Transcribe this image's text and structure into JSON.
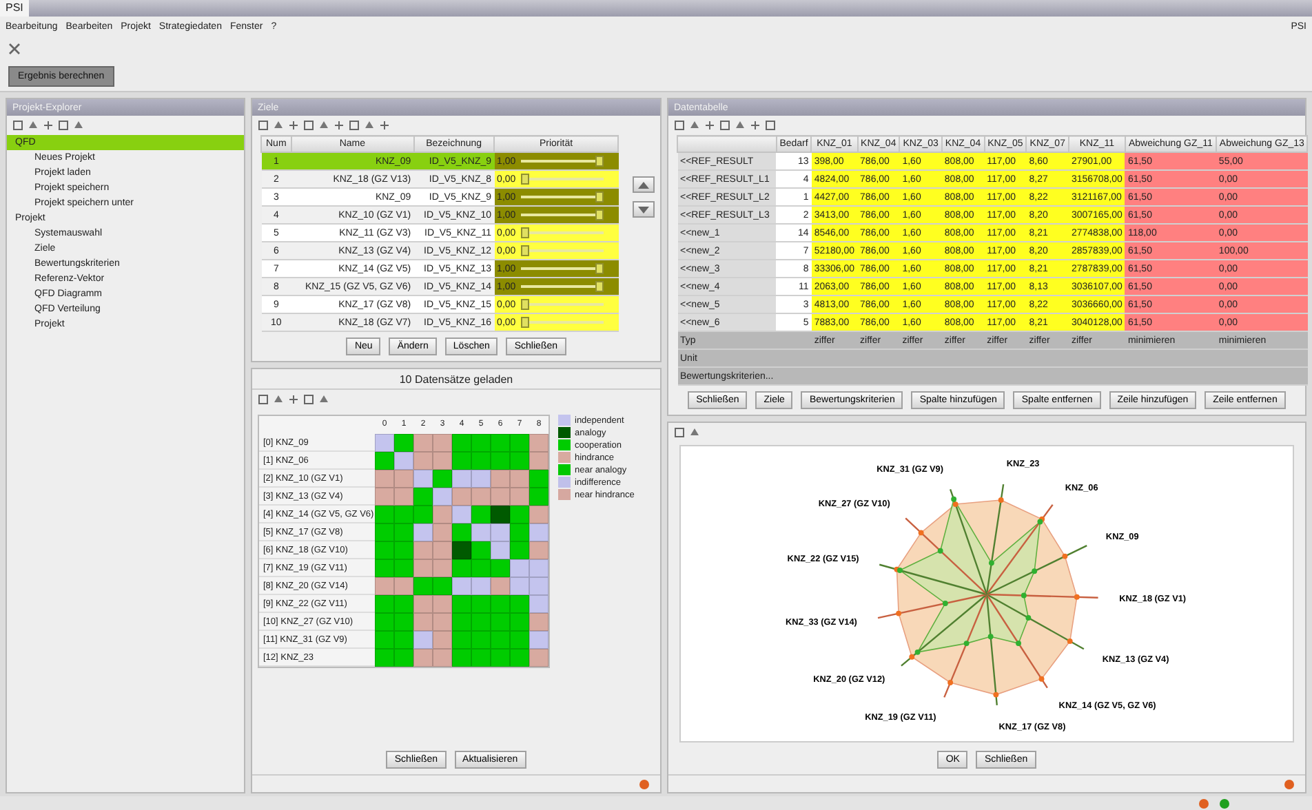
{
  "window": {
    "logo": "PSI",
    "brand": "PSI"
  },
  "menu": [
    "Bearbeitung",
    "Bearbeiten",
    "Projekt",
    "Strategiedaten",
    "Fenster",
    "?"
  ],
  "action_button": "Ergebnis berechnen",
  "sidebar": {
    "title": "Projekt-Explorer",
    "items": [
      {
        "label": "QFD",
        "selected": true,
        "children": [
          {
            "label": "Neues Projekt",
            "selected": false
          },
          {
            "label": "Projekt laden",
            "selected": false
          },
          {
            "label": "Projekt speichern",
            "selected": false
          },
          {
            "label": "Projekt speichern unter",
            "selected": false
          }
        ]
      },
      {
        "label": "Projekt",
        "selected": false,
        "children": [
          {
            "label": "Systemauswahl",
            "selected": false
          },
          {
            "label": "Ziele",
            "selected": false
          },
          {
            "label": "Bewertungskriterien",
            "selected": false
          },
          {
            "label": "Referenz-Vektor",
            "selected": false
          },
          {
            "label": "QFD Diagramm",
            "selected": false
          },
          {
            "label": "QFD Verteilung",
            "selected": false
          },
          {
            "label": "Projekt",
            "selected": false
          }
        ]
      }
    ]
  },
  "goals": {
    "title": "Ziele",
    "columns": [
      "Num",
      "Name",
      "Bezeichnung",
      "Priorität"
    ],
    "rows": [
      {
        "num": "1",
        "name": "KNZ_09",
        "code": "ID_V5_KNZ_9",
        "priority": "1,00",
        "level": 1,
        "selected": true
      },
      {
        "num": "2",
        "name": "KNZ_18 (GZ V13)",
        "code": "ID_V5_KNZ_8",
        "priority": "0,00",
        "level": 0,
        "selected": false
      },
      {
        "num": "3",
        "name": "KNZ_09",
        "code": "ID_V5_KNZ_9",
        "priority": "1,00",
        "level": 1,
        "selected": false
      },
      {
        "num": "4",
        "name": "KNZ_10 (GZ V1)",
        "code": "ID_V5_KNZ_10",
        "priority": "1,00",
        "level": 1,
        "selected": false
      },
      {
        "num": "5",
        "name": "KNZ_11 (GZ V3)",
        "code": "ID_V5_KNZ_11",
        "priority": "0,00",
        "level": 0,
        "selected": false
      },
      {
        "num": "6",
        "name": "KNZ_13 (GZ V4)",
        "code": "ID_V5_KNZ_12",
        "priority": "0,00",
        "level": 0,
        "selected": false
      },
      {
        "num": "7",
        "name": "KNZ_14 (GZ V5)",
        "code": "ID_V5_KNZ_13",
        "priority": "1,00",
        "level": 1,
        "selected": false
      },
      {
        "num": "8",
        "name": "KNZ_15 (GZ V5, GZ V6)",
        "code": "ID_V5_KNZ_14",
        "priority": "1,00",
        "level": 1,
        "selected": false
      },
      {
        "num": "9",
        "name": "KNZ_17 (GZ V8)",
        "code": "ID_V5_KNZ_15",
        "priority": "0,00",
        "level": 0,
        "selected": false
      },
      {
        "num": "10",
        "name": "KNZ_18 (GZ V7)",
        "code": "ID_V5_KNZ_16",
        "priority": "0,00",
        "level": 0,
        "selected": false
      }
    ],
    "buttons": [
      "Neu",
      "Ändern",
      "Löschen",
      "Schließen"
    ]
  },
  "matrix": {
    "status": "10 Datensätze geladen",
    "columns": [
      "0",
      "1",
      "2",
      "3",
      "4",
      "5",
      "6",
      "7",
      "8"
    ],
    "legend": [
      {
        "label": "independent",
        "color": "#c4c4ee"
      },
      {
        "label": "analogy",
        "color": "#005a00"
      },
      {
        "label": "cooperation",
        "color": "#00cc00"
      },
      {
        "label": "hindrance",
        "color": "#d8aaa0"
      },
      {
        "label": "near analogy",
        "color": "#00c800"
      },
      {
        "label": "indifference",
        "color": "#c0c0ea"
      },
      {
        "label": "near hindrance",
        "color": "#d6a8a0"
      }
    ],
    "rows": [
      {
        "label": "[0] KNZ_09",
        "cells": [
          {
            "color": "#c4c4ee"
          },
          {
            "color": "#00cc00"
          },
          {
            "color": "#d8aaa0"
          },
          {
            "color": "#d8aaa0"
          },
          {
            "color": "#00cc00"
          },
          {
            "color": "#00cc00"
          },
          {
            "color": "#00cc00"
          },
          {
            "color": "#00cc00"
          },
          {
            "color": "#d8aaa0"
          }
        ]
      },
      {
        "label": "[1] KNZ_06",
        "cells": [
          {
            "color": "#00cc00"
          },
          {
            "color": "#c4c4ee"
          },
          {
            "color": "#d8aaa0"
          },
          {
            "color": "#d8aaa0"
          },
          {
            "color": "#00cc00"
          },
          {
            "color": "#00cc00"
          },
          {
            "color": "#00cc00"
          },
          {
            "color": "#00cc00"
          },
          {
            "color": "#d8aaa0"
          }
        ]
      },
      {
        "label": "[2] KNZ_10 (GZ V1)",
        "cells": [
          {
            "color": "#d8aaa0"
          },
          {
            "color": "#d8aaa0"
          },
          {
            "color": "#c4c4ee"
          },
          {
            "color": "#00cc00"
          },
          {
            "color": "#c4c4ee"
          },
          {
            "color": "#c4c4ee"
          },
          {
            "color": "#d8aaa0"
          },
          {
            "color": "#d8aaa0"
          },
          {
            "color": "#00cc00"
          }
        ]
      },
      {
        "label": "[3] KNZ_13 (GZ V4)",
        "cells": [
          {
            "color": "#d8aaa0"
          },
          {
            "color": "#d8aaa0"
          },
          {
            "color": "#00cc00"
          },
          {
            "color": "#c4c4ee"
          },
          {
            "color": "#d8aaa0"
          },
          {
            "color": "#d8aaa0"
          },
          {
            "color": "#d8aaa0"
          },
          {
            "color": "#d8aaa0"
          },
          {
            "color": "#00cc00"
          }
        ]
      },
      {
        "label": "[4] KNZ_14 (GZ V5, GZ V6)",
        "cells": [
          {
            "color": "#00cc00"
          },
          {
            "color": "#00cc00"
          },
          {
            "color": "#00cc00"
          },
          {
            "color": "#d8aaa0"
          },
          {
            "color": "#c4c4ee"
          },
          {
            "color": "#00cc00"
          },
          {
            "color": "#005a00"
          },
          {
            "color": "#00cc00"
          },
          {
            "color": "#d8aaa0"
          }
        ]
      },
      {
        "label": "[5] KNZ_17 (GZ V8)",
        "cells": [
          {
            "color": "#00cc00"
          },
          {
            "color": "#00cc00"
          },
          {
            "color": "#c4c4ee"
          },
          {
            "color": "#d8aaa0"
          },
          {
            "color": "#00cc00"
          },
          {
            "color": "#c4c4ee"
          },
          {
            "color": "#c4c4ee"
          },
          {
            "color": "#00cc00"
          },
          {
            "color": "#c4c4ee"
          }
        ]
      },
      {
        "label": "[6] KNZ_18 (GZ V10)",
        "cells": [
          {
            "color": "#00cc00"
          },
          {
            "color": "#00cc00"
          },
          {
            "color": "#d8aaa0"
          },
          {
            "color": "#d8aaa0"
          },
          {
            "color": "#005a00"
          },
          {
            "color": "#00cc00"
          },
          {
            "color": "#c4c4ee"
          },
          {
            "color": "#00cc00"
          },
          {
            "color": "#d8aaa0"
          }
        ]
      },
      {
        "label": "[7] KNZ_19 (GZ V11)",
        "cells": [
          {
            "color": "#00cc00"
          },
          {
            "color": "#00cc00"
          },
          {
            "color": "#d8aaa0"
          },
          {
            "color": "#d8aaa0"
          },
          {
            "color": "#00cc00"
          },
          {
            "color": "#00cc00"
          },
          {
            "color": "#00cc00"
          },
          {
            "color": "#c4c4ee"
          },
          {
            "color": "#c4c4ee"
          }
        ]
      },
      {
        "label": "[8] KNZ_20 (GZ V14)",
        "cells": [
          {
            "color": "#d8aaa0"
          },
          {
            "color": "#d8aaa0"
          },
          {
            "color": "#00cc00"
          },
          {
            "color": "#00cc00"
          },
          {
            "color": "#c4c4ee"
          },
          {
            "color": "#c4c4ee"
          },
          {
            "color": "#d8aaa0"
          },
          {
            "color": "#c4c4ee"
          },
          {
            "color": "#c4c4ee"
          }
        ]
      },
      {
        "label": "[9] KNZ_22 (GZ V11)",
        "cells": [
          {
            "color": "#00cc00"
          },
          {
            "color": "#00cc00"
          },
          {
            "color": "#d8aaa0"
          },
          {
            "color": "#d8aaa0"
          },
          {
            "color": "#00cc00"
          },
          {
            "color": "#00cc00"
          },
          {
            "color": "#00cc00"
          },
          {
            "color": "#00cc00"
          },
          {
            "color": "#c4c4ee"
          }
        ]
      },
      {
        "label": "[10] KNZ_27 (GZ V10)",
        "cells": [
          {
            "color": "#00cc00"
          },
          {
            "color": "#00cc00"
          },
          {
            "color": "#d8aaa0"
          },
          {
            "color": "#d8aaa0"
          },
          {
            "color": "#00cc00"
          },
          {
            "color": "#00cc00"
          },
          {
            "color": "#00cc00"
          },
          {
            "color": "#00cc00"
          },
          {
            "color": "#d8aaa0"
          }
        ]
      },
      {
        "label": "[11] KNZ_31 (GZ V9)",
        "cells": [
          {
            "color": "#00cc00"
          },
          {
            "color": "#00cc00"
          },
          {
            "color": "#c4c4ee"
          },
          {
            "color": "#d8aaa0"
          },
          {
            "color": "#00cc00"
          },
          {
            "color": "#00cc00"
          },
          {
            "color": "#00cc00"
          },
          {
            "color": "#00cc00"
          },
          {
            "color": "#c4c4ee"
          }
        ]
      },
      {
        "label": "[12] KNZ_23",
        "cells": [
          {
            "color": "#00cc00"
          },
          {
            "color": "#00cc00"
          },
          {
            "color": "#d8aaa0"
          },
          {
            "color": "#d8aaa0"
          },
          {
            "color": "#00cc00"
          },
          {
            "color": "#00cc00"
          },
          {
            "color": "#00cc00"
          },
          {
            "color": "#00cc00"
          },
          {
            "color": "#d8aaa0"
          }
        ]
      }
    ],
    "buttons": [
      "Schließen",
      "Aktualisieren"
    ]
  },
  "data_table": {
    "title": "Datentabelle",
    "columns": [
      {
        "label": "Bedarf",
        "kind": "count"
      },
      {
        "label": "KNZ_01",
        "kind": "value"
      },
      {
        "label": "KNZ_04",
        "kind": "value"
      },
      {
        "label": "KNZ_03",
        "kind": "value"
      },
      {
        "label": "KNZ_04",
        "kind": "value"
      },
      {
        "label": "KNZ_05",
        "kind": "value"
      },
      {
        "label": "KNZ_07",
        "kind": "value"
      },
      {
        "label": "KNZ_11",
        "kind": "value"
      },
      {
        "label": "Abweichung GZ_11",
        "kind": "deviation"
      },
      {
        "label": "Abweichung GZ_13",
        "kind": "deviation"
      }
    ],
    "rows": [
      {
        "label": "<<REF_RESULT",
        "cells": [
          "13",
          "398,00",
          "786,00",
          "1,60",
          "808,00",
          "117,00",
          "8,60",
          "27901,00",
          "61,50",
          "55,00"
        ]
      },
      {
        "label": "<<REF_RESULT_L1",
        "cells": [
          "4",
          "4824,00",
          "786,00",
          "1,60",
          "808,00",
          "117,00",
          "8,27",
          "3156708,00",
          "61,50",
          "0,00"
        ]
      },
      {
        "label": "<<REF_RESULT_L2",
        "cells": [
          "1",
          "4427,00",
          "786,00",
          "1,60",
          "808,00",
          "117,00",
          "8,22",
          "3121167,00",
          "61,50",
          "0,00"
        ]
      },
      {
        "label": "<<REF_RESULT_L3",
        "cells": [
          "2",
          "3413,00",
          "786,00",
          "1,60",
          "808,00",
          "117,00",
          "8,20",
          "3007165,00",
          "61,50",
          "0,00"
        ]
      },
      {
        "label": "<<new_1",
        "cells": [
          "14",
          "8546,00",
          "786,00",
          "1,60",
          "808,00",
          "117,00",
          "8,21",
          "2774838,00",
          "118,00",
          "0,00"
        ]
      },
      {
        "label": "<<new_2",
        "cells": [
          "7",
          "52180,00",
          "786,00",
          "1,60",
          "808,00",
          "117,00",
          "8,20",
          "2857839,00",
          "61,50",
          "100,00"
        ]
      },
      {
        "label": "<<new_3",
        "cells": [
          "8",
          "33306,00",
          "786,00",
          "1,60",
          "808,00",
          "117,00",
          "8,21",
          "2787839,00",
          "61,50",
          "0,00"
        ]
      },
      {
        "label": "<<new_4",
        "cells": [
          "11",
          "2063,00",
          "786,00",
          "1,60",
          "808,00",
          "117,00",
          "8,13",
          "3036107,00",
          "61,50",
          "0,00"
        ]
      },
      {
        "label": "<<new_5",
        "cells": [
          "3",
          "4813,00",
          "786,00",
          "1,60",
          "808,00",
          "117,00",
          "8,22",
          "3036660,00",
          "61,50",
          "0,00"
        ]
      },
      {
        "label": "<<new_6",
        "cells": [
          "5",
          "7883,00",
          "786,00",
          "1,60",
          "808,00",
          "117,00",
          "8,21",
          "3040128,00",
          "61,50",
          "0,00"
        ]
      }
    ],
    "footer_rows": [
      {
        "label": "Typ",
        "cells": [
          "",
          "ziffer",
          "ziffer",
          "ziffer",
          "ziffer",
          "ziffer",
          "ziffer",
          "ziffer",
          "minimieren",
          "minimieren"
        ]
      },
      {
        "label": "Unit",
        "cells": []
      },
      {
        "label": "Bewertungskriterien...",
        "cells": []
      }
    ],
    "buttons": [
      "Schließen",
      "Ziele",
      "Bewertungskriterien",
      "Spalte hinzufügen",
      "Spalte entfernen",
      "Zeile hinzufügen",
      "Zeile entfernen"
    ]
  },
  "radar": {
    "right_axes": [
      "KNZ_23",
      "KNZ_06",
      "KNZ_09",
      "KNZ_18 (GZ V1)",
      "KNZ_13 (GZ V4)",
      "KNZ_14 (GZ V5, GZ V6)",
      "KNZ_17 (GZ V8)"
    ],
    "left_axes": [
      "KNZ_31 (GZ V9)",
      "KNZ_27 (GZ V10)",
      "KNZ_22 (GZ V15)",
      "KNZ_33 (GZ V14)",
      "KNZ_20 (GZ V12)",
      "KNZ_19 (GZ V11)"
    ],
    "buttons": [
      "OK",
      "Schließen"
    ]
  }
}
